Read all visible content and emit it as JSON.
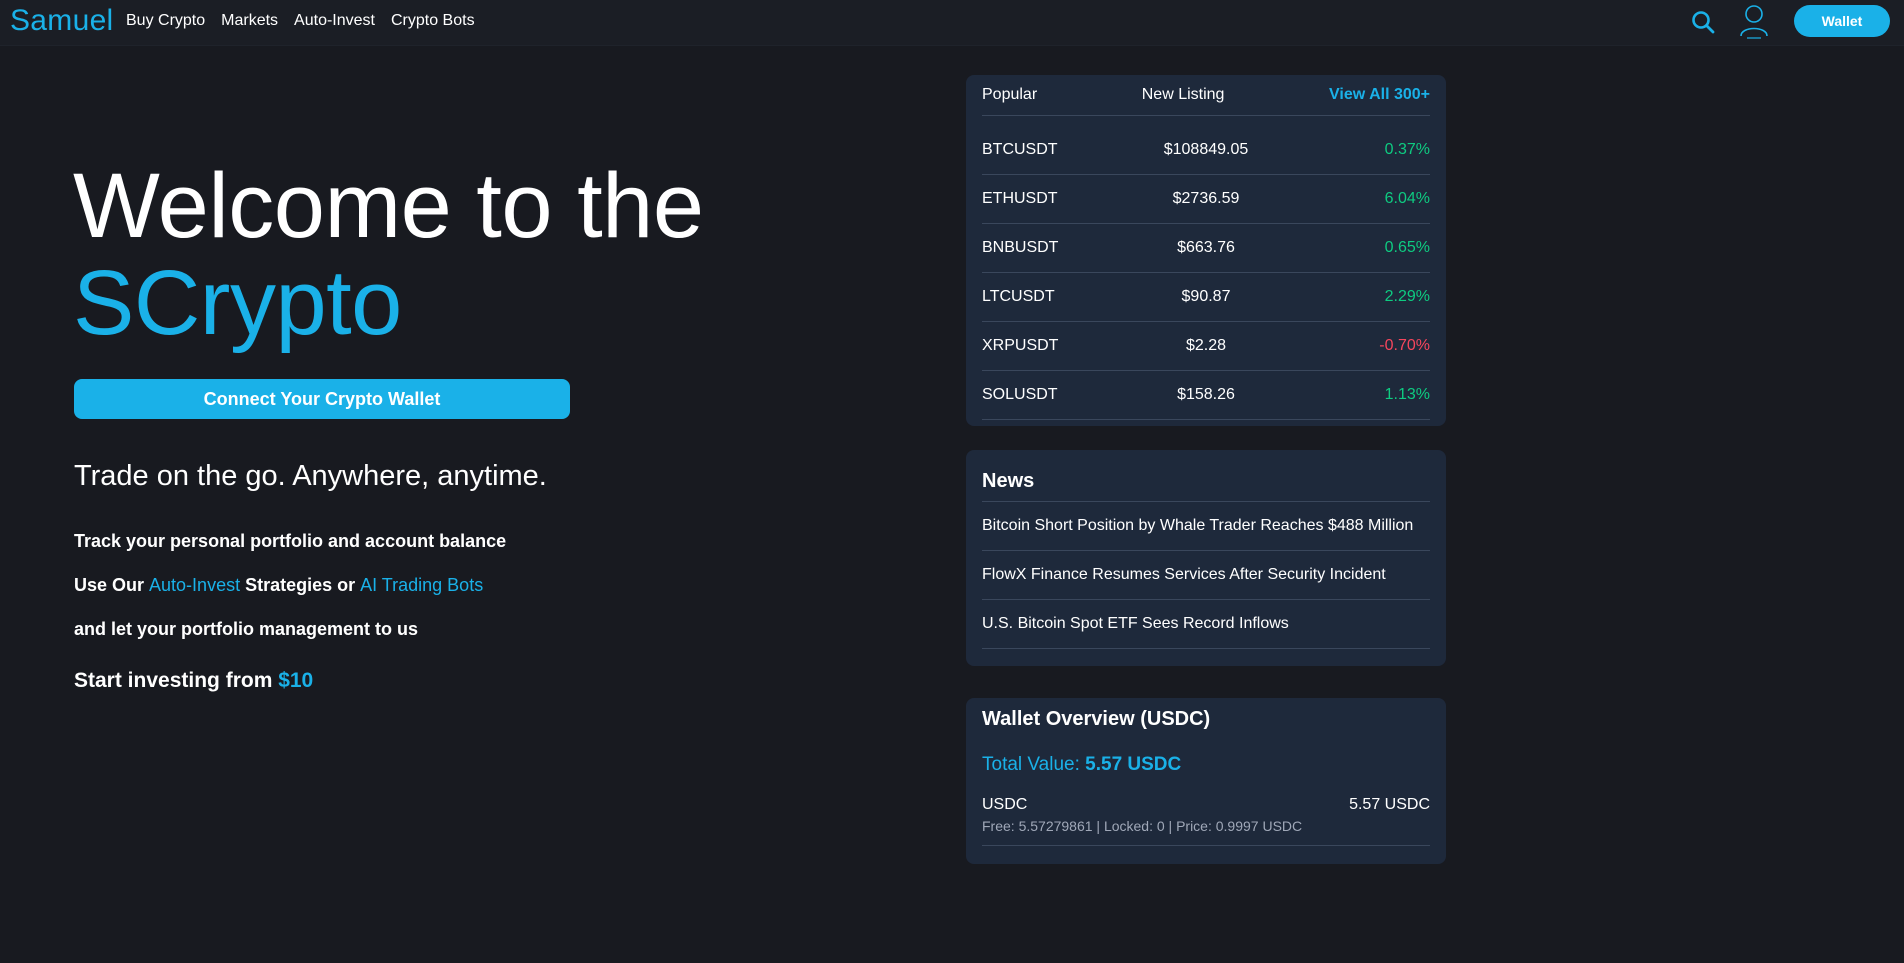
{
  "brand": "Samuel",
  "nav": {
    "links": [
      "Buy Crypto",
      "Markets",
      "Auto-Invest",
      "Crypto Bots"
    ],
    "wallet_label": "Wallet",
    "search_icon": "search-icon",
    "user_icon": "user-icon"
  },
  "hero": {
    "title_line1": "Welcome to the",
    "title_line2": "SCrypto",
    "connect_label": "Connect Your Crypto Wallet",
    "tagline": "Trade on the go. Anywhere, anytime.",
    "feature1": "Track your personal portfolio and account balance",
    "feature2_prefix": "Use Our ",
    "feature2_link1": "Auto-Invest",
    "feature2_mid": " Strategies or ",
    "feature2_link2": "AI Trading Bots",
    "feature3": "and let your portfolio management to us",
    "start_prefix": "Start investing from ",
    "start_amount": "$10"
  },
  "markets": {
    "tabs": {
      "popular": "Popular",
      "new_listing": "New Listing",
      "view_all": "View All 300+"
    },
    "rows": [
      {
        "symbol": "BTCUSDT",
        "price": "$108849.05",
        "change": "0.37%",
        "direction": "up"
      },
      {
        "symbol": "ETHUSDT",
        "price": "$2736.59",
        "change": "6.04%",
        "direction": "up"
      },
      {
        "symbol": "BNBUSDT",
        "price": "$663.76",
        "change": "0.65%",
        "direction": "up"
      },
      {
        "symbol": "LTCUSDT",
        "price": "$90.87",
        "change": "2.29%",
        "direction": "up"
      },
      {
        "symbol": "XRPUSDT",
        "price": "$2.28",
        "change": "-0.70%",
        "direction": "down"
      },
      {
        "symbol": "SOLUSDT",
        "price": "$158.26",
        "change": "1.13%",
        "direction": "up"
      }
    ]
  },
  "news": {
    "title": "News",
    "items": [
      "Bitcoin Short Position by Whale Trader Reaches $488 Million",
      "FlowX Finance Resumes Services After Security Incident",
      "U.S. Bitcoin Spot ETF Sees Record Inflows"
    ]
  },
  "wallet": {
    "title": "Wallet Overview (USDC)",
    "total_label": "Total Value: ",
    "total_value": "5.57 USDC",
    "assets": [
      {
        "name": "USDC",
        "amount": "5.57 USDC",
        "details": "Free: 5.57279861 | Locked: 0 | Price: 0.9997 USDC"
      }
    ]
  },
  "colors": {
    "accent": "#1ab1e8",
    "background": "#181a20",
    "card": "#1e293b",
    "up": "#0ecb81",
    "down": "#f6465d"
  }
}
